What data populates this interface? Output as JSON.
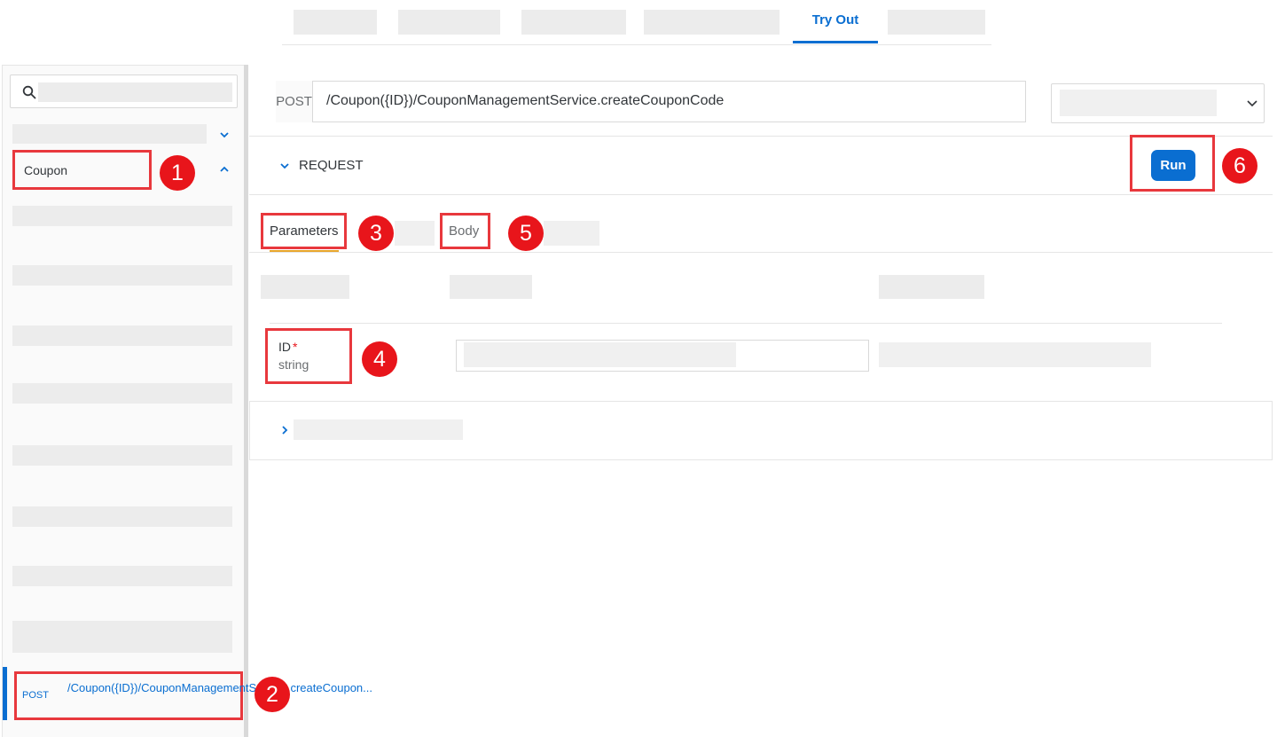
{
  "top_tabs": {
    "active_label": "Try Out"
  },
  "sidebar": {
    "search_placeholder": "",
    "group_label": "Coupon",
    "selected_endpoint": {
      "method": "POST",
      "path": "/Coupon({ID})/CouponManagementService.createCoupon..."
    }
  },
  "request_bar": {
    "method": "POST",
    "path": "/Coupon({ID})/CouponManagementService.createCouponCode"
  },
  "request_panel": {
    "label": "REQUEST",
    "run_label": "Run"
  },
  "sub_tabs": {
    "parameters_label": "Parameters",
    "body_label": "Body"
  },
  "parameter_row": {
    "name": "ID",
    "required_marker": "*",
    "type": "string"
  },
  "badges": [
    "1",
    "2",
    "3",
    "4",
    "5",
    "6"
  ],
  "colors": {
    "accent": "#0a6ed1",
    "highlight_frame": "#e8383d",
    "badge": "#e8151b",
    "tab_underline": "#e9a52a"
  },
  "icons": [
    "search-icon",
    "chevron-down-icon",
    "chevron-up-icon",
    "chevron-right-icon"
  ]
}
